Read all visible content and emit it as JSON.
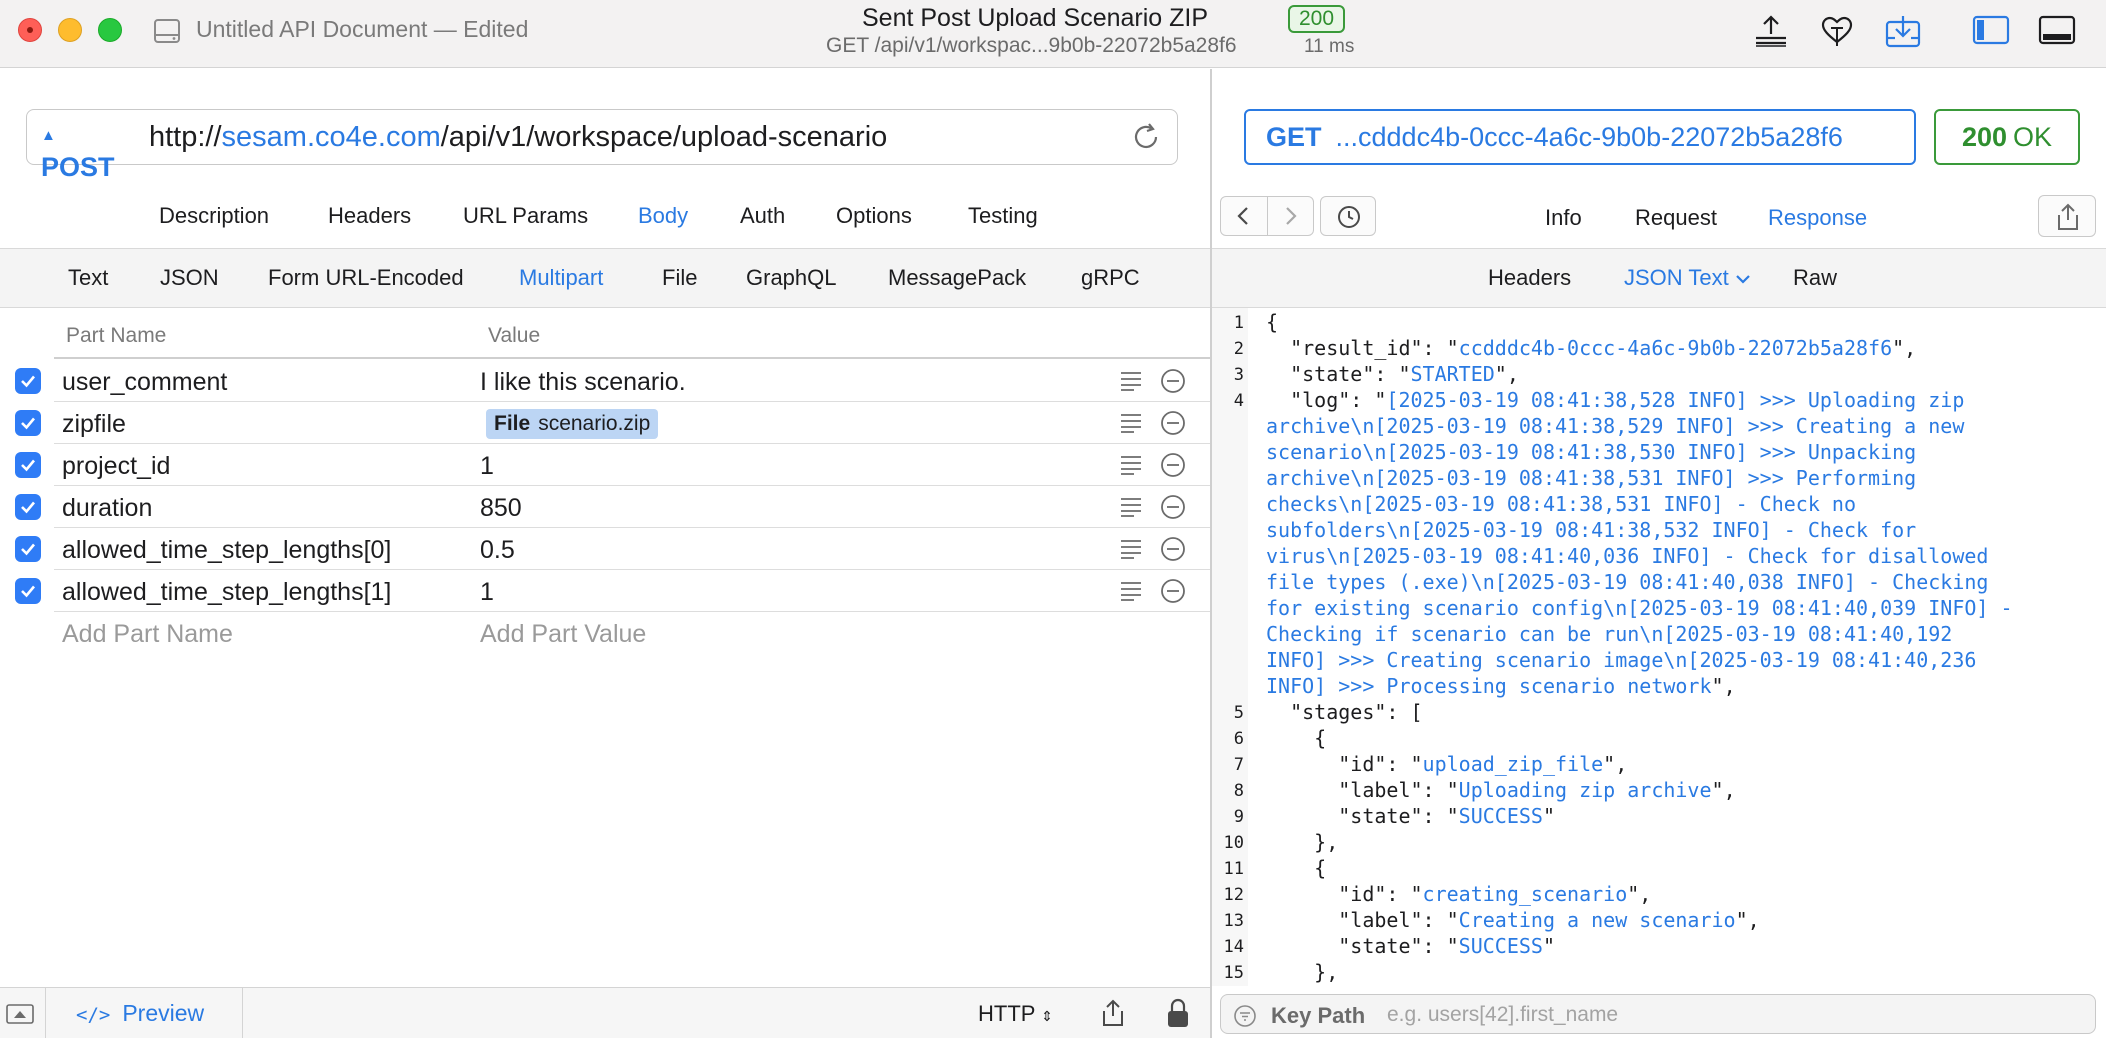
{
  "window": {
    "doc_title": "Untitled API Document — Edited",
    "request_title": "Sent Post Upload Scenario ZIP",
    "status_code": "200",
    "request_summary": "GET /api/v1/workspac...9b0b-22072b5a28f6",
    "duration": "11 ms"
  },
  "request": {
    "method": "POST",
    "url_scheme": "http://",
    "url_host": "sesam.co4e.com",
    "url_path": "/api/v1/workspace/upload-scenario",
    "tabs": [
      "Description",
      "Headers",
      "URL Params",
      "Body",
      "Auth",
      "Options",
      "Testing"
    ],
    "active_tab": "Body",
    "body_types": [
      "Text",
      "JSON",
      "Form URL-Encoded",
      "Multipart",
      "File",
      "GraphQL",
      "MessagePack",
      "gRPC"
    ],
    "active_body_type": "Multipart",
    "columns": {
      "name": "Part Name",
      "value": "Value"
    },
    "parts": [
      {
        "name": "user_comment",
        "value": "I like this scenario.",
        "checked": true
      },
      {
        "name": "zipfile",
        "file_tag": "File",
        "value": "scenario.zip",
        "checked": true
      },
      {
        "name": "project_id",
        "value": "1",
        "checked": true
      },
      {
        "name": "duration",
        "value": "850",
        "checked": true
      },
      {
        "name": "allowed_time_step_lengths[0]",
        "value": "0.5",
        "checked": true
      },
      {
        "name": "allowed_time_step_lengths[1]",
        "value": "1",
        "checked": true
      }
    ],
    "add_name_placeholder": "Add Part Name",
    "add_value_placeholder": "Add Part Value"
  },
  "footer": {
    "preview_label": "Preview",
    "preview_code": "</>",
    "protocol": "HTTP"
  },
  "response": {
    "method": "GET",
    "url_snippet": "...cdddc4b-0ccc-4a6c-9b0b-22072b5a28f6",
    "status_code": "200",
    "status_text": "OK",
    "tabs": [
      "Info",
      "Request",
      "Response"
    ],
    "active_tab": "Response",
    "sub_tabs": [
      "Headers",
      "JSON Text",
      "Raw"
    ],
    "active_sub_tab": "JSON Text",
    "code_lines": [
      {
        "n": "1",
        "text": "{"
      },
      {
        "n": "2",
        "text": "  \"result_id\": \"ccdddc4b-0ccc-4a6c-9b0b-22072b5a28f6\","
      },
      {
        "n": "3",
        "text": "  \"state\": \"STARTED\","
      },
      {
        "n": "4",
        "text": "  \"log\": \"[2025-03-19 08:41:38,528 INFO] >>> Uploading zip"
      },
      {
        "n": "",
        "text": "archive\\n[2025-03-19 08:41:38,529 INFO] >>> Creating a new"
      },
      {
        "n": "",
        "text": "scenario\\n[2025-03-19 08:41:38,530 INFO] >>> Unpacking"
      },
      {
        "n": "",
        "text": "archive\\n[2025-03-19 08:41:38,531 INFO] >>> Performing"
      },
      {
        "n": "",
        "text": "checks\\n[2025-03-19 08:41:38,531 INFO] - Check no"
      },
      {
        "n": "",
        "text": "subfolders\\n[2025-03-19 08:41:38,532 INFO] - Check for"
      },
      {
        "n": "",
        "text": "virus\\n[2025-03-19 08:41:40,036 INFO] - Check for disallowed"
      },
      {
        "n": "",
        "text": "file types (.exe)\\n[2025-03-19 08:41:40,038 INFO] - Checking"
      },
      {
        "n": "",
        "text": "for existing scenario config\\n[2025-03-19 08:41:40,039 INFO] -"
      },
      {
        "n": "",
        "text": "Checking if scenario can be run\\n[2025-03-19 08:41:40,192"
      },
      {
        "n": "",
        "text": "INFO] >>> Creating scenario image\\n[2025-03-19 08:41:40,236"
      },
      {
        "n": "",
        "text": "INFO] >>> Processing scenario network\","
      },
      {
        "n": "5",
        "text": "  \"stages\": ["
      },
      {
        "n": "6",
        "text": "    {"
      },
      {
        "n": "7",
        "text": "      \"id\": \"upload_zip_file\","
      },
      {
        "n": "8",
        "text": "      \"label\": \"Uploading zip archive\","
      },
      {
        "n": "9",
        "text": "      \"state\": \"SUCCESS\""
      },
      {
        "n": "10",
        "text": "    },"
      },
      {
        "n": "11",
        "text": "    {"
      },
      {
        "n": "12",
        "text": "      \"id\": \"creating_scenario\","
      },
      {
        "n": "13",
        "text": "      \"label\": \"Creating a new scenario\","
      },
      {
        "n": "14",
        "text": "      \"state\": \"SUCCESS\""
      },
      {
        "n": "15",
        "text": "    },"
      }
    ],
    "key_path_label": "Key Path",
    "key_path_placeholder": "e.g. users[42].first_name"
  },
  "icons": {
    "doc": "document-drive-icon",
    "toolbar": [
      "upload-tray-icon",
      "cookie-heart-icon",
      "download-tray-icon",
      "sidebar-left-icon",
      "panel-bottom-icon"
    ]
  },
  "colors": {
    "accent": "#2a7ae2",
    "success": "#2f8f2f",
    "checkbox": "#2f7cf6",
    "string": "#2a7ae2"
  }
}
